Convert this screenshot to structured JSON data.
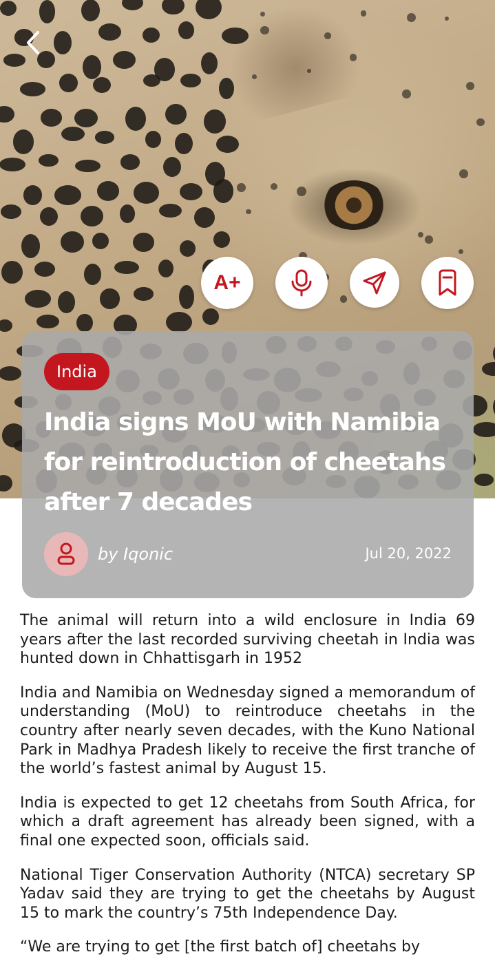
{
  "header": {
    "back_icon": "chevron-left-icon"
  },
  "actions": {
    "font_size_label": "A+",
    "items": [
      "text-size-icon",
      "microphone-icon",
      "send-icon",
      "bookmark-icon"
    ],
    "accent_color": "#c3161f"
  },
  "article": {
    "category": "India",
    "title": "India signs MoU with Namibia for reintroduction of cheetahs after 7 decades",
    "author": "by Iqonic",
    "date": "Jul 20, 2022",
    "paragraphs": [
      "The animal will return into a wild enclosure in India 69 years after the last recorded surviving cheetah in India was hunted down in Chhattisgarh in 1952",
      "India and Namibia on Wednesday signed a memorandum of understanding (MoU) to reintroduce cheetahs in the country after nearly seven decades, with the Kuno National Park in Madhya Pradesh likely to receive the first tranche of the world’s fastest animal by August 15.",
      "India is expected to get 12 cheetahs from South Africa, for which a draft agreement has already been signed, with a final one expected soon, officials said.",
      "National Tiger Conservation Authority (NTCA) secretary SP Yadav said they are trying to get the cheetahs by August 15 to mark the country’s 75th Independence Day.",
      "“We are trying to get [the first batch of] cheetahs by"
    ]
  }
}
